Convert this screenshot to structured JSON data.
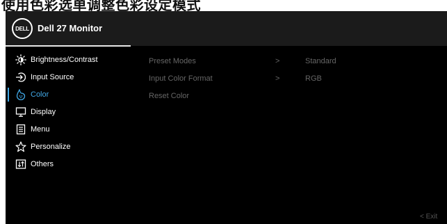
{
  "caption": "使用色彩选单调整色彩设定模式",
  "header": {
    "logo_text": "DELL",
    "title": "Dell 27 Monitor"
  },
  "menu": {
    "items": [
      {
        "label": "Brightness/Contrast",
        "icon": "brightness-icon"
      },
      {
        "label": "Input Source",
        "icon": "input-source-icon"
      },
      {
        "label": "Color",
        "icon": "color-icon",
        "active": true
      },
      {
        "label": "Display",
        "icon": "display-icon"
      },
      {
        "label": "Menu",
        "icon": "menu-icon"
      },
      {
        "label": "Personalize",
        "icon": "star-icon"
      },
      {
        "label": "Others",
        "icon": "others-icon"
      }
    ]
  },
  "submenu": {
    "rows": [
      {
        "label": "Preset Modes",
        "arrow": ">",
        "value": "Standard"
      },
      {
        "label": "Input Color Format",
        "arrow": ">",
        "value": "RGB"
      },
      {
        "label": "Reset Color",
        "arrow": "",
        "value": ""
      }
    ]
  },
  "footer": {
    "exit_label": "< Exit"
  },
  "colors": {
    "accent": "#41a8e6",
    "background": "#000000",
    "header": "#1b1b1b",
    "submenu_text": "#666666"
  }
}
